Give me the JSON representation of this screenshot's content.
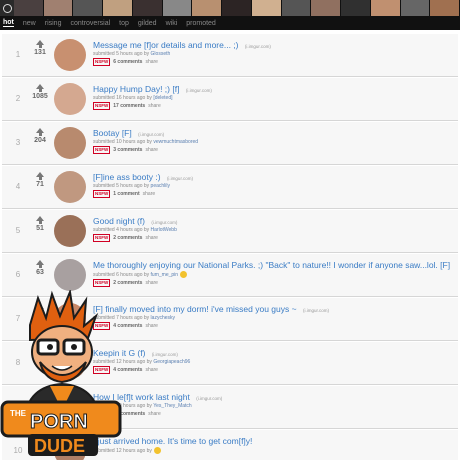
{
  "header": {
    "tabs": [
      {
        "label": "hot",
        "active": true
      },
      {
        "label": "new",
        "active": false
      },
      {
        "label": "rising",
        "active": false
      },
      {
        "label": "controversial",
        "active": false
      },
      {
        "label": "top",
        "active": false
      },
      {
        "label": "gilded",
        "active": false
      },
      {
        "label": "wiki",
        "active": false
      },
      {
        "label": "promoted",
        "active": false
      }
    ],
    "thumb_colors": [
      "#4a4040",
      "#a08070",
      "#555",
      "#c0a080",
      "#3a3030",
      "#888",
      "#b89070",
      "#2c2424",
      "#d0b090",
      "#555",
      "#907060",
      "#303030",
      "#c09070",
      "#666",
      "#a07050"
    ]
  },
  "posts": [
    {
      "rank": "1",
      "score": "131",
      "title": "Message me [f]or details and more... ;)",
      "domain": "(i.imgur.com)",
      "submitted": "submitted 5 hours ago by",
      "author": "Glosseth",
      "comments": "6 comments",
      "share": "share",
      "nsfw": "NSFW",
      "thumb_color": "#c89070"
    },
    {
      "rank": "2",
      "score": "1085",
      "title": "Happy Hump Day! ;) [f]",
      "domain": "(i.imgur.com)",
      "submitted": "submitted 16 hours ago by",
      "author": "[deleted]",
      "comments": "17 comments",
      "share": "share",
      "nsfw": "NSFW",
      "thumb_color": "#d4a890"
    },
    {
      "rank": "3",
      "score": "204",
      "title": "Bootay [F]",
      "domain": "(i.imgur.com)",
      "submitted": "submitted 10 hours ago by",
      "author": "vewmuchtmasbored",
      "comments": "3 comments",
      "share": "share",
      "nsfw": "NSFW",
      "thumb_color": "#b88a6e"
    },
    {
      "rank": "4",
      "score": "71",
      "title": "[F]ine ass booty :)",
      "domain": "(i.imgur.com)",
      "submitted": "submitted 5 hours ago by",
      "author": "peachlily",
      "comments": "1 comment",
      "share": "share",
      "nsfw": "NSFW",
      "thumb_color": "#c09880"
    },
    {
      "rank": "5",
      "score": "51",
      "title": "Good night (f)",
      "domain": "(i.imgur.com)",
      "submitted": "submitted 4 hours ago by",
      "author": "HarlotWebb",
      "comments": "2 comments",
      "share": "share",
      "nsfw": "NSFW",
      "thumb_color": "#9a7058"
    },
    {
      "rank": "6",
      "score": "63",
      "title": "Me thoroughly enjoying our National Parks. ;) \"Back\" to nature!! I wonder if anyone saw...lol. [F]",
      "domain": "(i.imgur.com)",
      "submitted": "submitted 6 hours ago by",
      "author": "fum_me_pin",
      "comments": "2 comments",
      "share": "share",
      "nsfw": "NSFW",
      "thumb_color": "#a8a0a0"
    },
    {
      "rank": "7",
      "score": "60",
      "title": "[F] finally moved into my dorm! i've missed you guys ~",
      "domain": "(i.imgur.com)",
      "submitted": "submitted 7 hours ago by",
      "author": "lazychesky",
      "comments": "4 comments",
      "share": "share",
      "nsfw": "NSFW",
      "thumb_color": "#c88868"
    },
    {
      "rank": "8",
      "score": "",
      "title": "Keepin it G (f)",
      "domain": "(i.imgur.com)",
      "submitted": "submitted 12 hours ago by",
      "author": "Georgiapeach96",
      "comments": "4 comments",
      "share": "share",
      "nsfw": "NSFW",
      "thumb_color": "#8a6048"
    },
    {
      "rank": "9",
      "score": "",
      "title": "How I le[f]t work last night",
      "domain": "(i.imgur.com)",
      "submitted": "submitted 10 hours ago by",
      "author": "Yes_They_Match",
      "comments": "15 comments",
      "share": "share",
      "nsfw": "NSFW",
      "thumb_color": "#6a5048"
    },
    {
      "rank": "10",
      "score": "",
      "title": "I just arrived home. It's time to get com[f]y!",
      "domain": "",
      "submitted": "submitted 12 hours ago by",
      "author": "",
      "comments": "",
      "share": "",
      "nsfw": "",
      "thumb_color": "#b08068"
    }
  ],
  "overlay": {
    "logo_the": "THE",
    "logo_porn": "PORN",
    "logo_dude": "DUDE",
    "colors": {
      "orange": "#f08a1c",
      "dark": "#1c1c1c",
      "skin": "#f0b080",
      "hair": "#e06010"
    }
  }
}
